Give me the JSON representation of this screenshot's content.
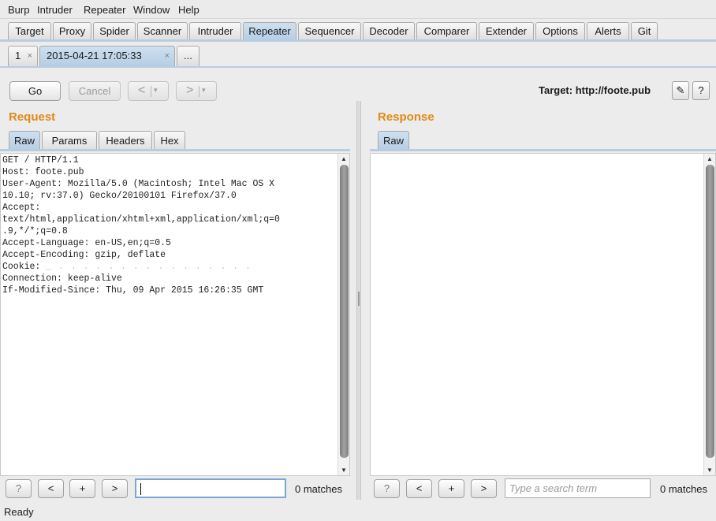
{
  "menu": [
    "Burp",
    "Intruder",
    "Repeater",
    "Window",
    "Help"
  ],
  "main_tabs": [
    "Target",
    "Proxy",
    "Spider",
    "Scanner",
    "Intruder",
    "Repeater",
    "Sequencer",
    "Decoder",
    "Comparer",
    "Extender",
    "Options",
    "Alerts",
    "Git"
  ],
  "main_tab_active": "Repeater",
  "sub_tabs": {
    "tab1": "1",
    "tab2": "2015-04-21 17:05:33",
    "close": "×",
    "more": "..."
  },
  "toolbar": {
    "go": "Go",
    "cancel": "Cancel",
    "back": "<",
    "forward": ">",
    "dropdown": "▾",
    "target": "Target: http://foote.pub",
    "edit_icon": "✎",
    "help": "?"
  },
  "request": {
    "title": "Request",
    "tabs": [
      "Raw",
      "Params",
      "Headers",
      "Hex"
    ],
    "lines": [
      "GET / HTTP/1.1",
      "Host: foote.pub",
      "User-Agent: Mozilla/5.0 (Macintosh; Intel Mac OS X",
      "10.10; rv:37.0) Gecko/20100101 Firefox/37.0",
      "Accept:",
      "text/html,application/xhtml+xml,application/xml;q=0",
      ".9,*/*;q=0.8",
      "Accept-Language: en-US,en;q=0.5",
      "Accept-Encoding: gzip, deflate"
    ],
    "cookie_label": "Cookie: ",
    "cookie_value": "_ . . . . . . . . . . . . . . . .",
    "lines_after": [
      "Connection: keep-alive",
      "If-Modified-Since: Thu, 09 Apr 2015 16:26:35 GMT"
    ],
    "search_value": "",
    "matches": "0 matches"
  },
  "response": {
    "title": "Response",
    "tabs": [
      "Raw"
    ],
    "search_placeholder": "Type a search term",
    "matches": "0 matches"
  },
  "search_buttons": {
    "help": "?",
    "prev": "<",
    "add": "+",
    "next": ">"
  },
  "scroll": {
    "up": "▲",
    "down": "▼"
  },
  "status": "Ready"
}
